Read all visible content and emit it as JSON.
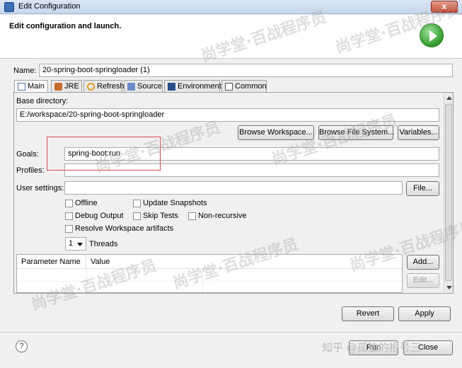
{
  "window": {
    "title": "Edit Configuration",
    "close_label": "x"
  },
  "header": {
    "title": "Edit configuration and launch."
  },
  "name": {
    "label": "Name:",
    "value": "20-spring-boot-springloader (1)"
  },
  "tabs": [
    {
      "label": "Main",
      "icon": "main-tab-icon",
      "active": true
    },
    {
      "label": "JRE",
      "icon": "jre-icon"
    },
    {
      "label": "Refresh",
      "icon": "refresh-icon"
    },
    {
      "label": "Source",
      "icon": "source-icon"
    },
    {
      "label": "Environment",
      "icon": "environment-icon"
    },
    {
      "label": "Common",
      "icon": "common-icon"
    }
  ],
  "main": {
    "base_dir_label": "Base directory:",
    "base_dir_value": "E:/workspace/20-spring-boot-springloader",
    "browse_workspace": "Browse Workspace...",
    "browse_fs": "Browse File System...",
    "variables": "Variables...",
    "goals_label": "Goals:",
    "goals_value": "spring-boot:run",
    "profiles_label": "Profiles:",
    "profiles_value": "",
    "user_settings_label": "User settings:",
    "user_settings_value": "",
    "file_button": "File...",
    "checkboxes": {
      "offline": "Offline",
      "update_snapshots": "Update Snapshots",
      "debug_output": "Debug Output",
      "skip_tests": "Skip Tests",
      "non_recursive": "Non-recursive",
      "resolve_workspace": "Resolve Workspace artifacts"
    },
    "threads_value": "1",
    "threads_label": "Threads",
    "param_col_name": "Parameter Name",
    "param_col_value": "Value",
    "add_button": "Add...",
    "edit_button": "Edit..."
  },
  "actions": {
    "revert": "Revert",
    "apply": "Apply",
    "run": "Run",
    "close": "Close"
  },
  "watermarks": [
    "尚学堂·百战程序员",
    "知乎 @孤独的根号三"
  ],
  "colors": {
    "highlight": "#d94a4a",
    "run_green": "#2e9a2c"
  }
}
